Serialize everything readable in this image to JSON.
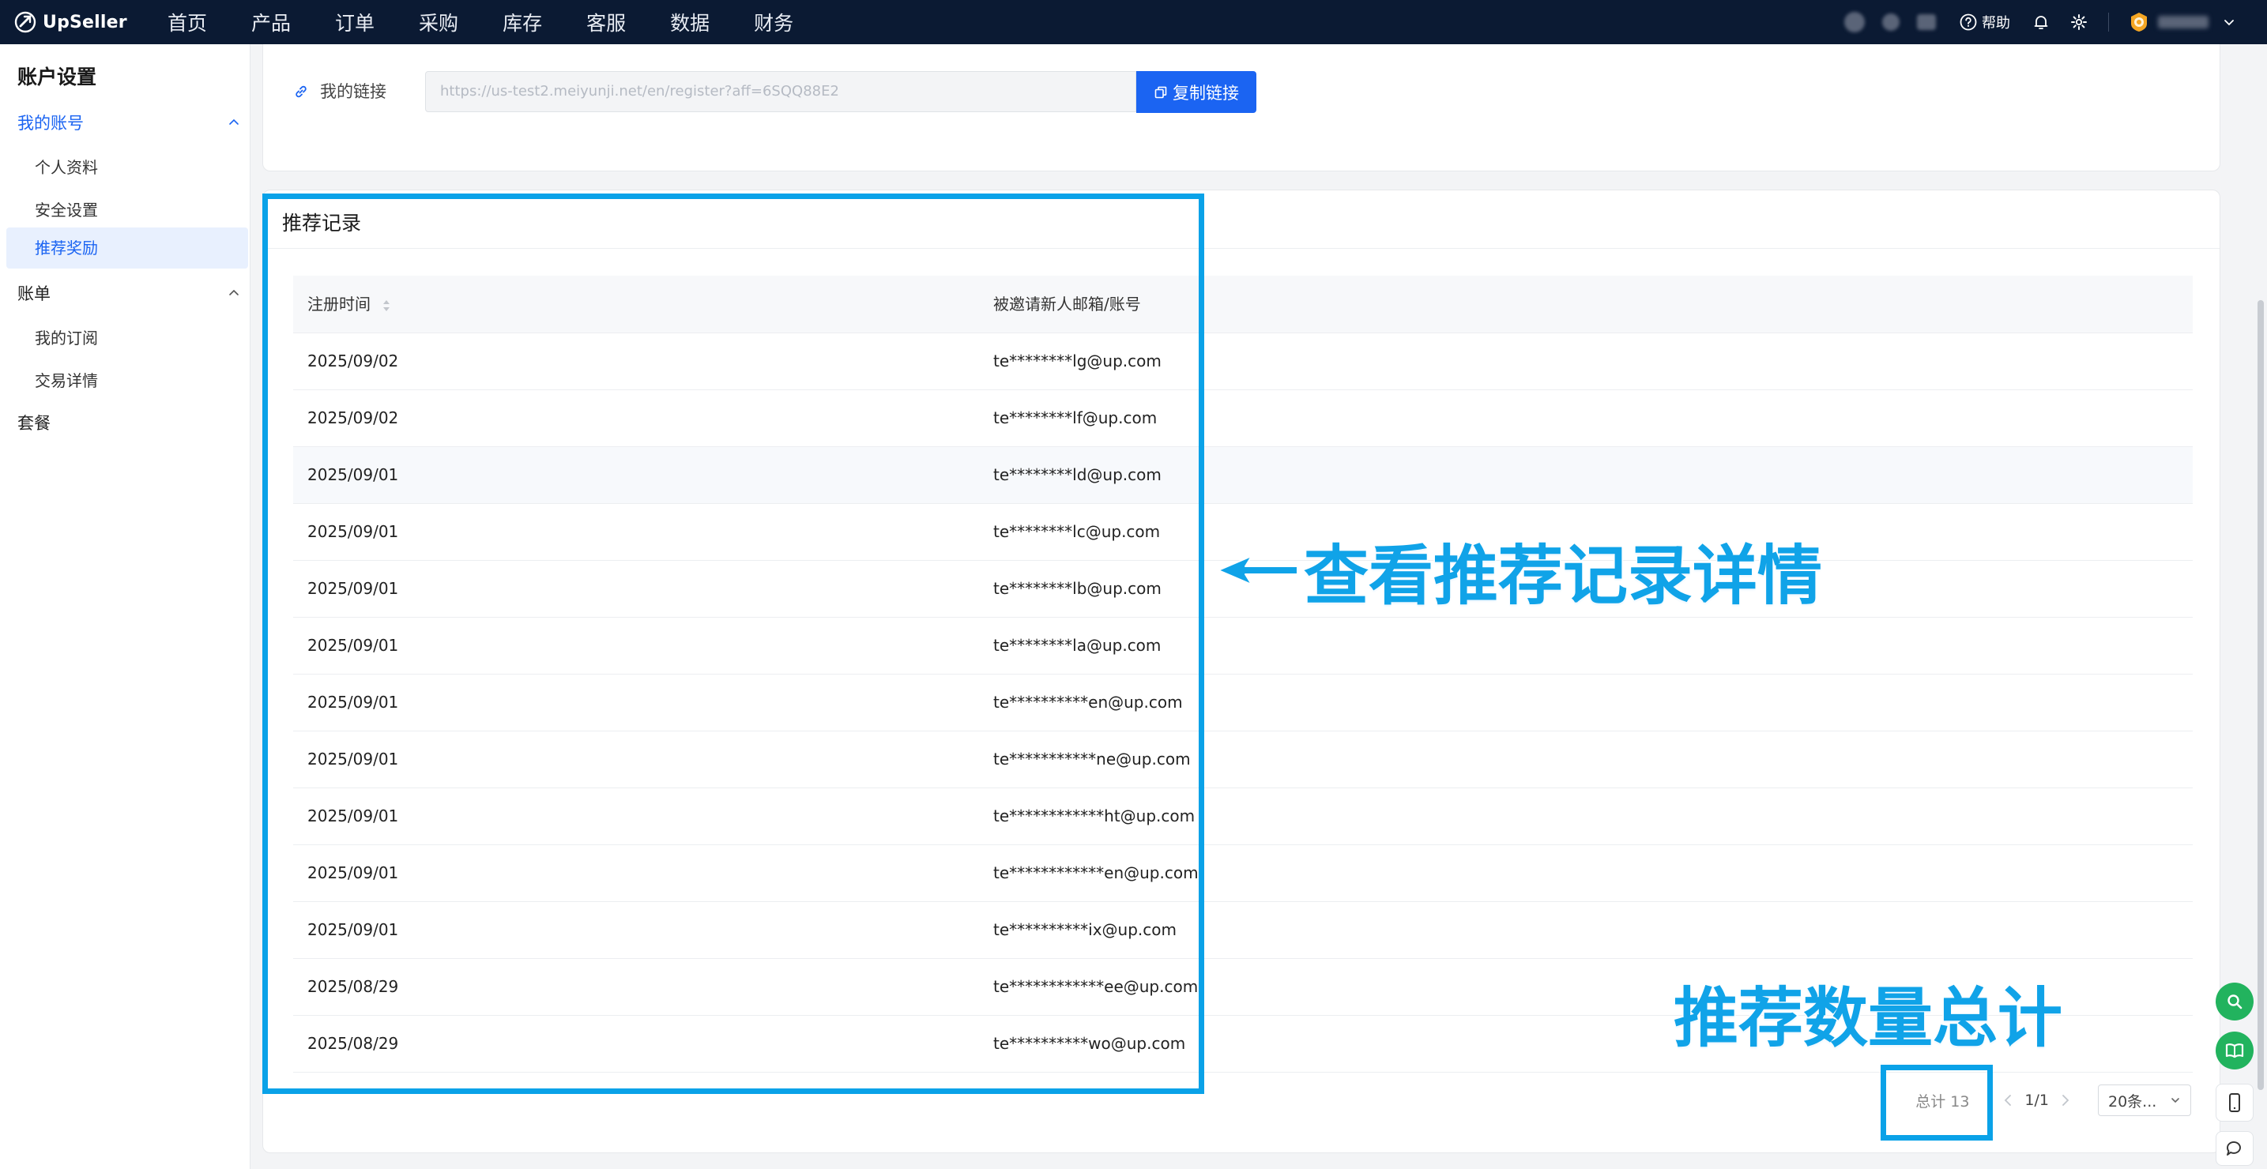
{
  "app": {
    "logo_text": "UpSeller",
    "nav": [
      "首页",
      "产品",
      "订单",
      "采购",
      "库存",
      "客服",
      "数据",
      "财务"
    ],
    "help_label": "帮助"
  },
  "sidebar": {
    "title": "账户设置",
    "groups": [
      {
        "label": "我的账号",
        "items": [
          "个人资料",
          "安全设置",
          "推荐奖励"
        ]
      },
      {
        "label": "账单",
        "items": [
          "我的订阅",
          "交易详情"
        ]
      },
      {
        "label": "套餐",
        "items": []
      }
    ],
    "selected": "推荐奖励"
  },
  "referral_link": {
    "label": "我的链接",
    "value": "https://us-test2.meiyunji.net/en/register?aff=6SQQ88E2",
    "copy_button": "复制链接"
  },
  "records": {
    "title": "推荐记录",
    "columns": [
      "注册时间",
      "被邀请新人邮箱/账号"
    ],
    "rows": [
      {
        "date": "2025/09/02",
        "email": "te********lg@up.com"
      },
      {
        "date": "2025/09/02",
        "email": "te********lf@up.com"
      },
      {
        "date": "2025/09/01",
        "email": "te********ld@up.com"
      },
      {
        "date": "2025/09/01",
        "email": "te********lc@up.com"
      },
      {
        "date": "2025/09/01",
        "email": "te********lb@up.com"
      },
      {
        "date": "2025/09/01",
        "email": "te********la@up.com"
      },
      {
        "date": "2025/09/01",
        "email": "te**********en@up.com"
      },
      {
        "date": "2025/09/01",
        "email": "te***********ne@up.com"
      },
      {
        "date": "2025/09/01",
        "email": "te************ht@up.com"
      },
      {
        "date": "2025/09/01",
        "email": "te************en@up.com"
      },
      {
        "date": "2025/09/01",
        "email": "te**********ix@up.com"
      },
      {
        "date": "2025/08/29",
        "email": "te************ee@up.com"
      },
      {
        "date": "2025/08/29",
        "email": "te**********wo@up.com"
      }
    ]
  },
  "pagination": {
    "total": "总计 13",
    "page": "1/1",
    "page_size": "20条..."
  },
  "annotations": {
    "records_callout": "查看推荐记录详情",
    "total_callout": "推荐数量总计"
  },
  "colors": {
    "topbar": "#0b1a33",
    "primary": "#1b64f2",
    "annotation": "#0aa2e8",
    "float_green": "#22b35e"
  }
}
